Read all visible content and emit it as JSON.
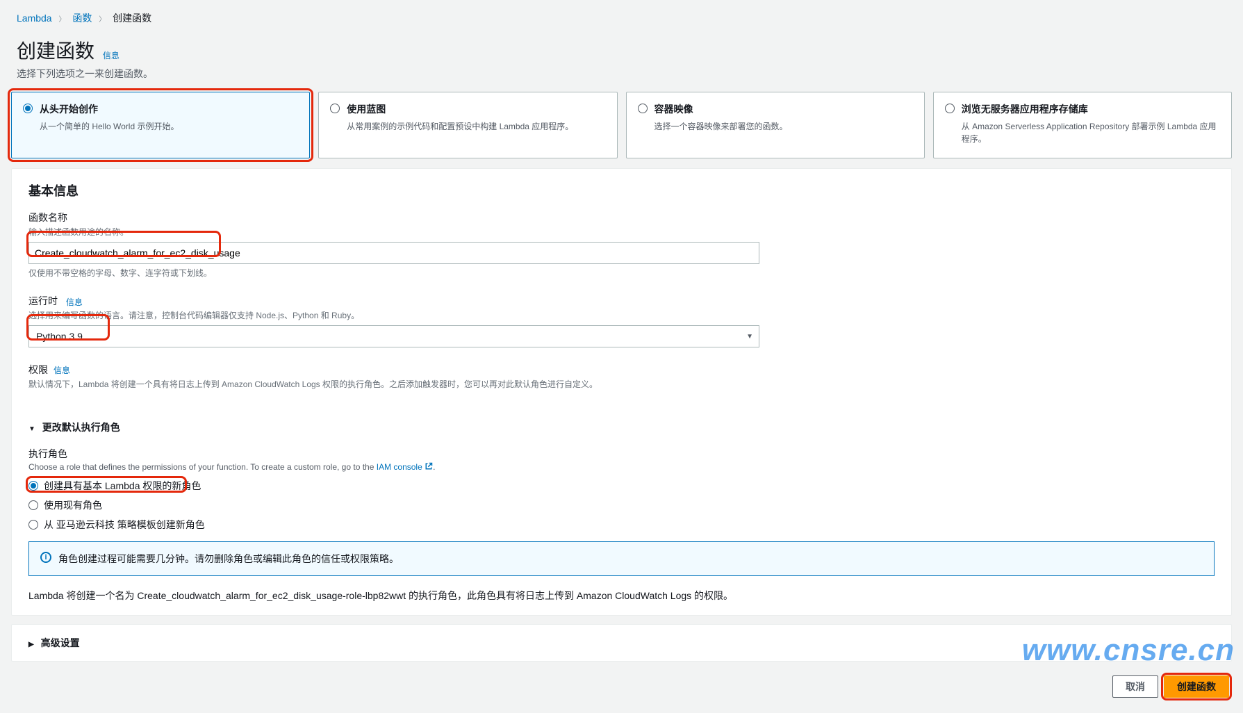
{
  "breadcrumb": {
    "root": "Lambda",
    "level2": "函数",
    "level3": "创建函数"
  },
  "header": {
    "title": "创建函数",
    "info": "信息",
    "subtitle": "选择下列选项之一来创建函数。"
  },
  "cards": {
    "scratch": {
      "title": "从头开始创作",
      "desc": "从一个简单的 Hello World 示例开始。"
    },
    "blueprint": {
      "title": "使用蓝图",
      "desc": "从常用案例的示例代码和配置预设中构建 Lambda 应用程序。"
    },
    "container": {
      "title": "容器映像",
      "desc": "选择一个容器映像来部署您的函数。"
    },
    "sar": {
      "title": "浏览无服务器应用程序存储库",
      "desc": "从 Amazon Serverless Application Repository 部署示例 Lambda 应用程序。"
    }
  },
  "basic": {
    "heading": "基本信息",
    "name_label": "函数名称",
    "name_hint": "输入描述函数用途的名称。",
    "name_value": "Create_cloudwatch_alarm_for_ec2_disk_usage",
    "name_hint2": "仅使用不带空格的字母、数字、连字符或下划线。",
    "runtime_label": "运行时",
    "runtime_info": "信息",
    "runtime_hint": "选择用来编写函数的语言。请注意，控制台代码编辑器仅支持 Node.js、Python 和 Ruby。",
    "runtime_value": "Python 3.9",
    "perm_label": "权限",
    "perm_info": "信息",
    "perm_hint": "默认情况下，Lambda 将创建一个具有将日志上传到 Amazon CloudWatch Logs 权限的执行角色。之后添加触发器时，您可以再对此默认角色进行自定义。"
  },
  "role": {
    "expander": "更改默认执行角色",
    "label": "执行角色",
    "hint_prefix": "Choose a role that defines the permissions of your function. To create a custom role, go to the ",
    "iam_link": "IAM console",
    "opt1": "创建具有基本 Lambda 权限的新角色",
    "opt2": "使用现有角色",
    "opt3": "从 亚马逊云科技 策略模板创建新角色",
    "info_text": "角色创建过程可能需要几分钟。请勿删除角色或编辑此角色的信任或权限策略。",
    "summary": "Lambda 将创建一个名为 Create_cloudwatch_alarm_for_ec2_disk_usage-role-lbp82wwt 的执行角色，此角色具有将日志上传到 Amazon CloudWatch Logs 的权限。"
  },
  "advanced": {
    "expander": "高级设置"
  },
  "footer": {
    "cancel": "取消",
    "create": "创建函数"
  },
  "watermark": "www.cnsre.cn"
}
